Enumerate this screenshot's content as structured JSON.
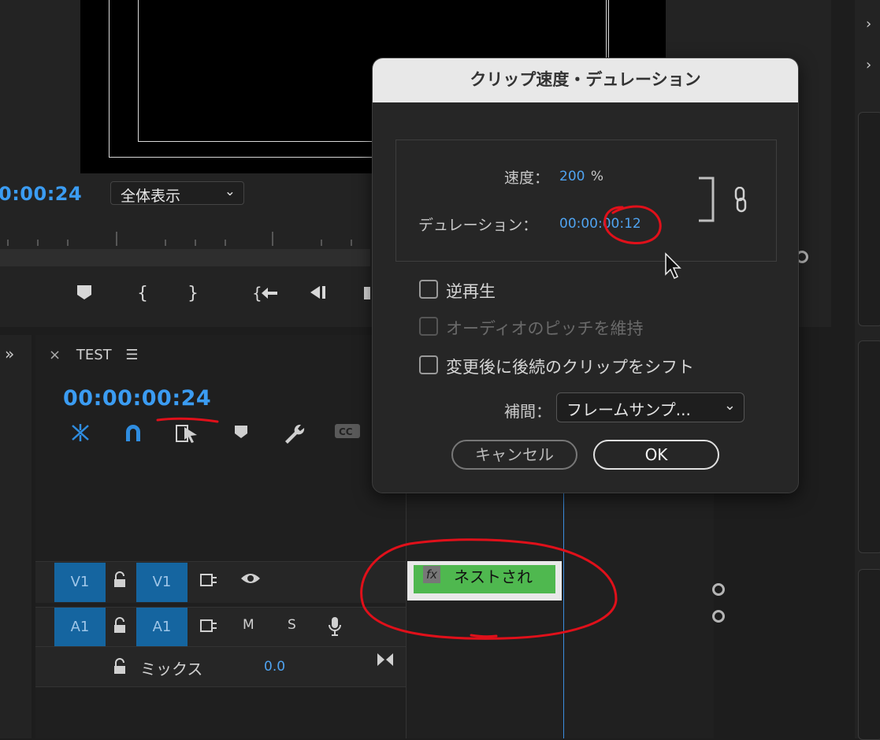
{
  "monitor": {
    "timecode": "0:00:24",
    "zoom_select": "全体表示"
  },
  "timeline": {
    "tab_title": "TEST",
    "timecode": "00:00:00:24",
    "tracks": {
      "video": {
        "source_label": "V1",
        "target_label": "V1"
      },
      "audio": {
        "source_label": "A1",
        "target_label": "A1",
        "mute": "M",
        "solo": "S"
      }
    },
    "mix": {
      "label": "ミックス",
      "value": "0.0"
    },
    "clip": {
      "label": "ネストされ",
      "fx": "fx"
    }
  },
  "dialog": {
    "title": "クリップ速度・デュレーション",
    "speed_label": "速度：",
    "speed_value": "200",
    "speed_unit": "%",
    "duration_label": "デュレーション：",
    "duration_value": "00:00:00:12",
    "reverse_label": "逆再生",
    "reverse_checked": false,
    "pitch_label": "オーディオのピッチを維持",
    "pitch_checked": false,
    "pitch_disabled": true,
    "ripple_label": "変更後に後続のクリップをシフト",
    "ripple_checked": false,
    "interp_label": "補間：",
    "interp_value": "フレームサンプ...",
    "cancel_label": "キャンセル",
    "ok_label": "OK"
  },
  "colors": {
    "accent_blue": "#3b9cf2",
    "clip_green": "#4fb84f",
    "track_button": "#1565a0",
    "annotation_red": "#e0101a"
  }
}
